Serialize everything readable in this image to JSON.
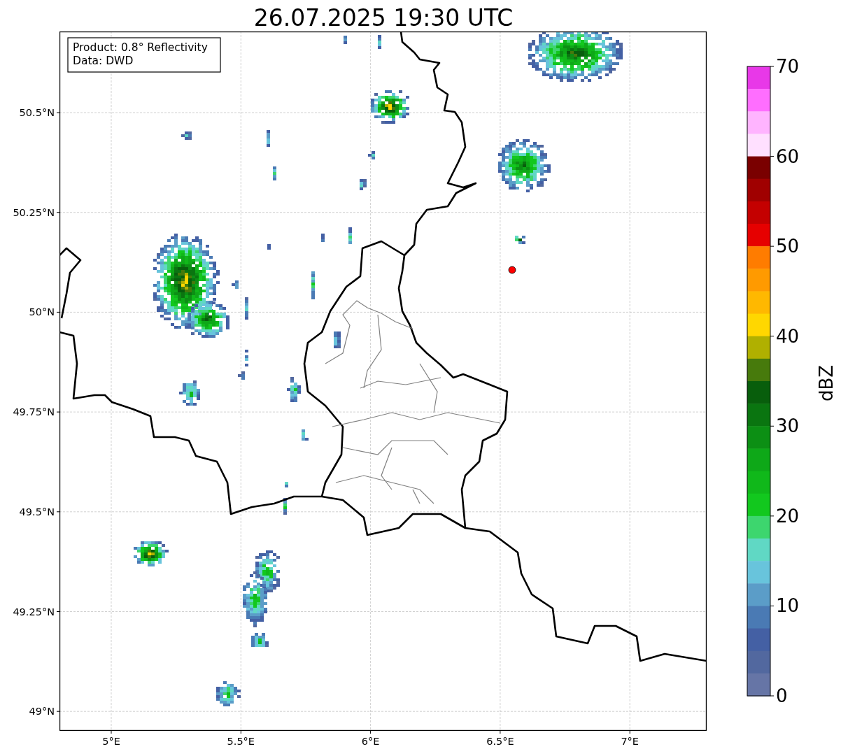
{
  "title": "26.07.2025 19:30 UTC",
  "annotation": {
    "lines": [
      "Product: 0.8° Reflectivity",
      "Data: DWD"
    ]
  },
  "axes": {
    "yticks": [
      "50.5°N",
      "50.25°N",
      "50°N",
      "49.75°N",
      "49.5°N",
      "49.25°N",
      "49°N"
    ],
    "xticks": [
      "5°E",
      "5.5°E",
      "6°E",
      "6.5°E",
      "7°E"
    ]
  },
  "colorbar": {
    "label": "dBZ",
    "ticks": [
      "70",
      "60",
      "50",
      "40",
      "30",
      "20",
      "10",
      "0"
    ],
    "bands": [
      {
        "color": "#e838e8"
      },
      {
        "color": "#ff6eff"
      },
      {
        "color": "#ffb4ff"
      },
      {
        "color": "#ffe0ff"
      },
      {
        "color": "#7a0000"
      },
      {
        "color": "#a00000"
      },
      {
        "color": "#c40000"
      },
      {
        "color": "#e60000"
      },
      {
        "color": "#ff7c00"
      },
      {
        "color": "#ff9a00"
      },
      {
        "color": "#ffb800"
      },
      {
        "color": "#ffd700"
      },
      {
        "color": "#b0b000"
      },
      {
        "color": "#477a0c"
      },
      {
        "color": "#085e0c"
      },
      {
        "color": "#0a7510"
      },
      {
        "color": "#0c8f14"
      },
      {
        "color": "#0ea818"
      },
      {
        "color": "#10b81a"
      },
      {
        "color": "#12c81e"
      },
      {
        "color": "#3dd66e"
      },
      {
        "color": "#60d8c4"
      },
      {
        "color": "#68c4dc"
      },
      {
        "color": "#5b9dc8"
      },
      {
        "color": "#4a7ab4"
      },
      {
        "color": "#4460a4"
      },
      {
        "color": "#52689f"
      },
      {
        "color": "#6675a6"
      }
    ]
  }
}
